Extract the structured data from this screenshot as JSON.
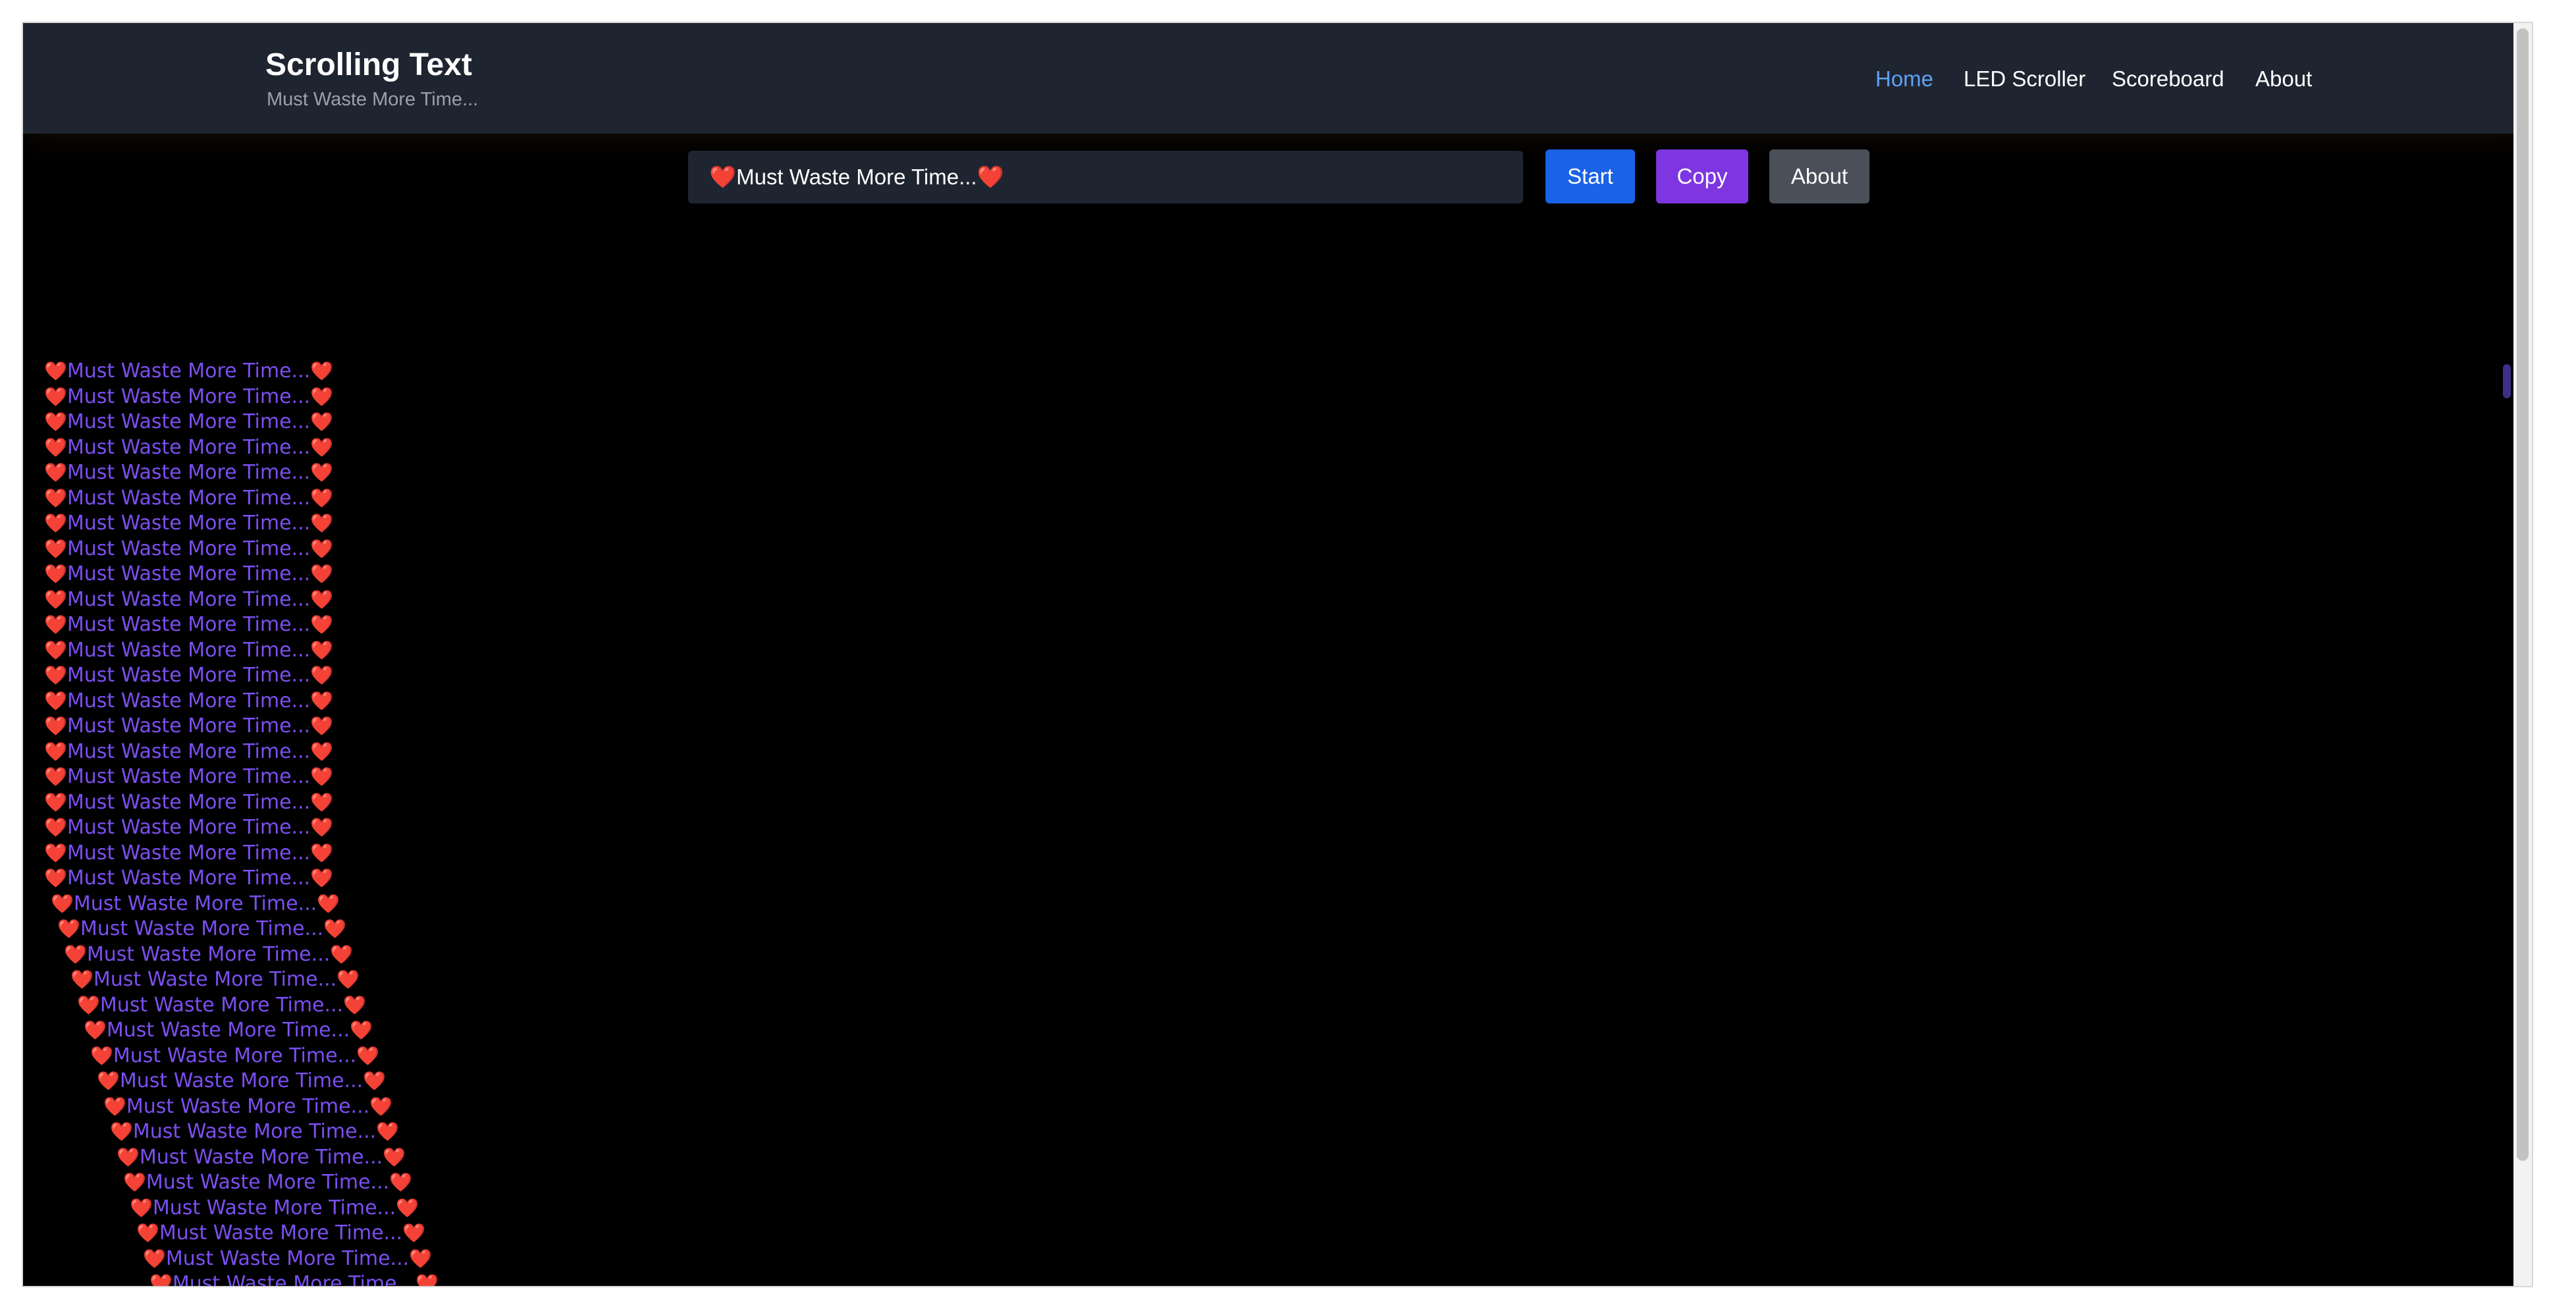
{
  "brand": {
    "title": "Scrolling Text",
    "subtitle": "Must Waste More Time..."
  },
  "nav": {
    "items": [
      {
        "label": "Home",
        "active": true
      },
      {
        "label": "LED Scroller",
        "active": false
      },
      {
        "label": "Scoreboard",
        "active": false
      },
      {
        "label": "About",
        "active": false
      }
    ]
  },
  "controls": {
    "input_value": "❤️Must Waste More Time...❤️",
    "start_label": "Start",
    "copy_label": "Copy",
    "about_label": "About"
  },
  "scroller": {
    "text": "Must Waste More Time...",
    "heart": "❤️",
    "line_count": 37,
    "text_color": "#7a4ff0"
  },
  "colors": {
    "header_bg": "#1f2530",
    "nav_active": "#5ea1f7",
    "start_button": "#1a62e6",
    "copy_button": "#7d36e0",
    "about_button": "#4a4f59",
    "page_bg": "#000000"
  }
}
